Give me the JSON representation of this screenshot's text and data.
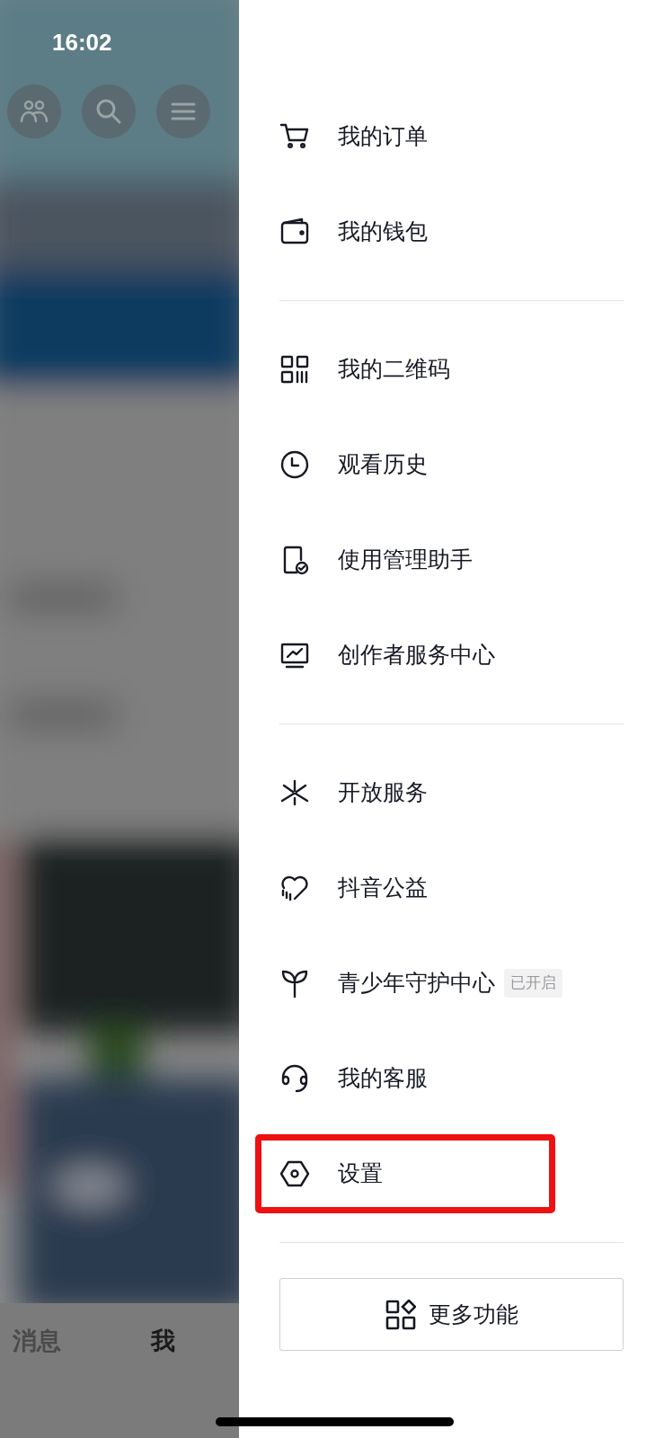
{
  "status_bar": {
    "time": "16:02"
  },
  "menu_groups": [
    {
      "items": [
        {
          "label": "我的订单",
          "highlighted": false
        },
        {
          "label": "我的钱包",
          "highlighted": false
        }
      ]
    },
    {
      "items": [
        {
          "label": "我的二维码",
          "highlighted": false
        },
        {
          "label": "观看历史",
          "highlighted": false
        },
        {
          "label": "使用管理助手",
          "highlighted": false
        },
        {
          "label": "创作者服务中心",
          "highlighted": false
        }
      ]
    },
    {
      "items": [
        {
          "label": "开放服务",
          "highlighted": false
        },
        {
          "label": "抖音公益",
          "highlighted": false
        },
        {
          "label": "青少年守护中心",
          "badge": "已开启",
          "highlighted": false
        },
        {
          "label": "我的客服",
          "highlighted": false
        },
        {
          "label": "设置",
          "highlighted": true
        }
      ]
    }
  ],
  "more_button": {
    "label": "更多功能"
  },
  "tab_bar": {
    "tabs": [
      {
        "label": "消息",
        "selected": false
      },
      {
        "label": "我",
        "selected": true
      }
    ]
  }
}
